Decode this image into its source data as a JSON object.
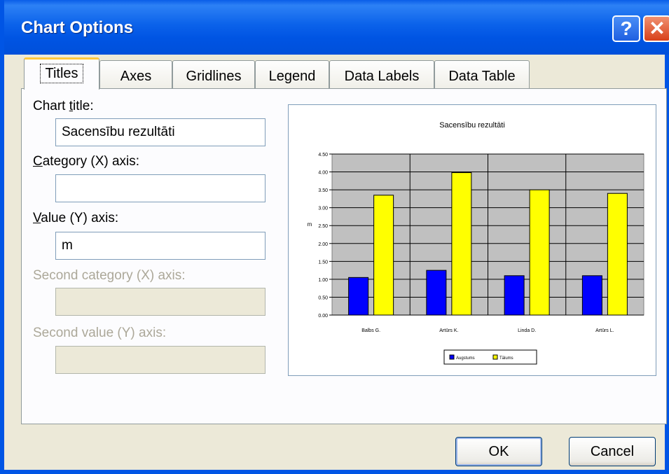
{
  "window": {
    "title": "Chart Options",
    "help_label": "?",
    "close_label": "✕"
  },
  "tabs": [
    {
      "label": "Titles",
      "active": true
    },
    {
      "label": "Axes"
    },
    {
      "label": "Gridlines"
    },
    {
      "label": "Legend"
    },
    {
      "label": "Data Labels"
    },
    {
      "label": "Data Table"
    }
  ],
  "form": {
    "chart_title": {
      "label_pre": "Chart ",
      "label_u": "t",
      "label_post": "itle:",
      "value": "Sacensību rezultāti"
    },
    "category_x": {
      "label_u": "C",
      "label_post": "ategory (X) axis:",
      "value": ""
    },
    "value_y": {
      "label_u": "V",
      "label_post": "alue (Y) axis:",
      "value": "m"
    },
    "second_category_x": {
      "label": "Second category (X) axis:",
      "value": ""
    },
    "second_value_y": {
      "label": "Second value (Y) axis:",
      "value": ""
    }
  },
  "buttons": {
    "ok": "OK",
    "cancel": "Cancel"
  },
  "chart_data": {
    "type": "bar",
    "title": "Sacensību rezultāti",
    "ylabel": "m",
    "xlabel": "",
    "categories": [
      "Balbs G.",
      "Artūrs K.",
      "Linda D.",
      "Artūrs L."
    ],
    "series": [
      {
        "name": "Augstums",
        "values": [
          1.05,
          1.25,
          1.1,
          1.1
        ],
        "color": "#0000ff"
      },
      {
        "name": "Tālums",
        "values": [
          3.35,
          3.98,
          3.5,
          3.4
        ],
        "color": "#ffff00"
      }
    ],
    "ylim": [
      0,
      4.5
    ],
    "yticks": [
      "0.00",
      "0.50",
      "1.00",
      "1.50",
      "2.00",
      "2.50",
      "3.00",
      "3.50",
      "4.00",
      "4.50"
    ],
    "grid": true,
    "plot_background": "#c0c0c0",
    "legend": "bottom"
  }
}
